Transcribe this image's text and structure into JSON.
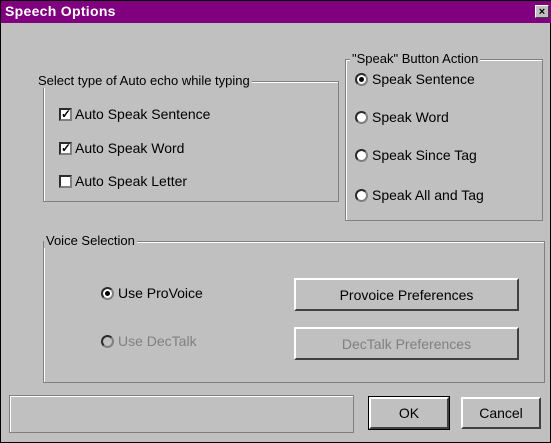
{
  "window": {
    "title": "Speech Options",
    "close_label": "×"
  },
  "autoecho": {
    "legend": "Select type of Auto echo while typing",
    "items": [
      {
        "label": "Auto Speak Sentence",
        "checked": true
      },
      {
        "label": "Auto Speak Word",
        "checked": true
      },
      {
        "label": "Auto Speak Letter",
        "checked": false
      }
    ]
  },
  "speakbutton": {
    "legend": "\"Speak\" Button Action",
    "items": [
      {
        "label": "Speak Sentence",
        "selected": true
      },
      {
        "label": "Speak Word",
        "selected": false
      },
      {
        "label": "Speak Since Tag",
        "selected": false
      },
      {
        "label": "Speak All and Tag",
        "selected": false
      }
    ]
  },
  "voice": {
    "legend": "Voice Selection",
    "provoice_label": "Use ProVoice",
    "provoice_selected": true,
    "dectalk_label": "Use DecTalk",
    "dectalk_selected": false,
    "provoice_prefs": "Provoice Preferences",
    "dectalk_prefs": "DecTalk Preferences"
  },
  "buttons": {
    "ok": "OK",
    "cancel": "Cancel"
  },
  "colors": {
    "title_bar": "#800080",
    "face": "#c0c0c0"
  }
}
